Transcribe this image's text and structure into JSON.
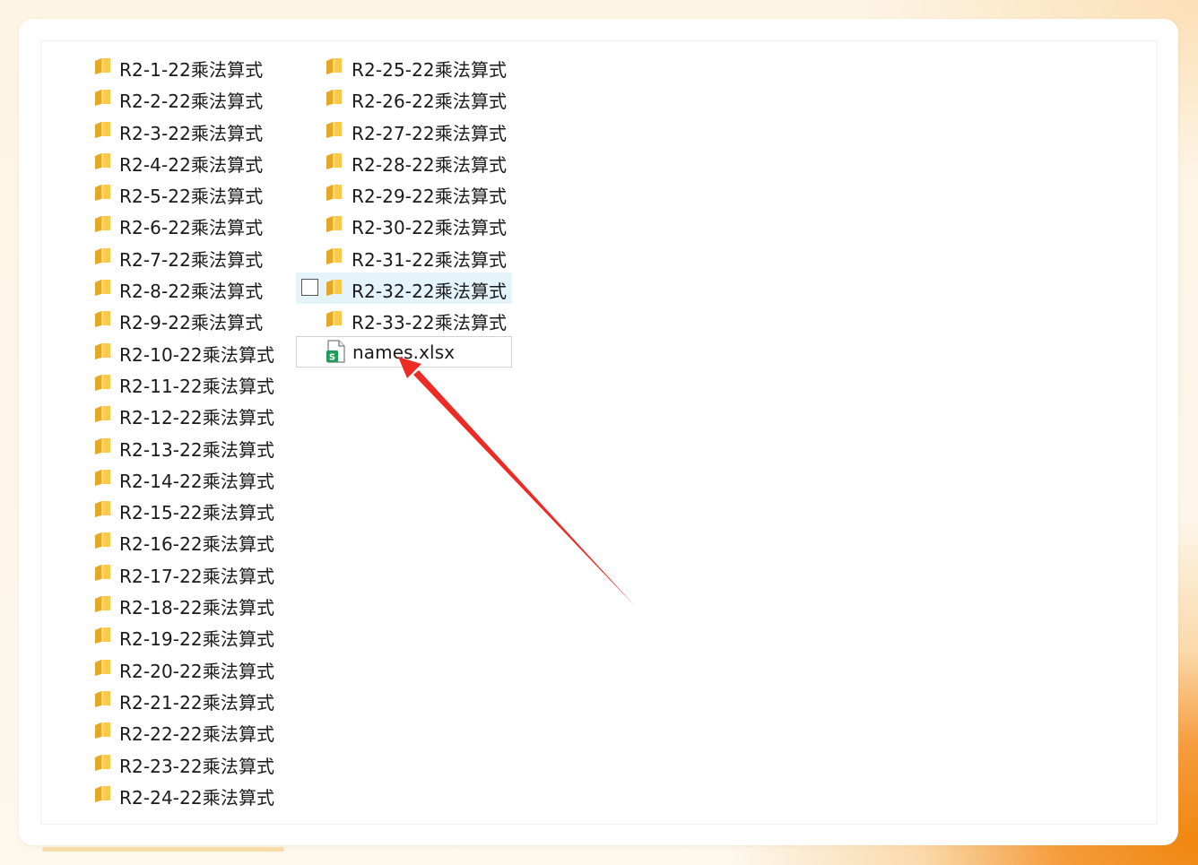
{
  "files_left": [
    "R2-1-22乘法算式",
    "R2-2-22乘法算式",
    "R2-3-22乘法算式",
    "R2-4-22乘法算式",
    "R2-5-22乘法算式",
    "R2-6-22乘法算式",
    "R2-7-22乘法算式",
    "R2-8-22乘法算式",
    "R2-9-22乘法算式",
    "R2-10-22乘法算式",
    "R2-11-22乘法算式",
    "R2-12-22乘法算式",
    "R2-13-22乘法算式",
    "R2-14-22乘法算式",
    "R2-15-22乘法算式",
    "R2-16-22乘法算式",
    "R2-17-22乘法算式",
    "R2-18-22乘法算式",
    "R2-19-22乘法算式",
    "R2-20-22乘法算式",
    "R2-21-22乘法算式",
    "R2-22-22乘法算式",
    "R2-23-22乘法算式",
    "R2-24-22乘法算式"
  ],
  "files_right": [
    "R2-25-22乘法算式",
    "R2-26-22乘法算式",
    "R2-27-22乘法算式",
    "R2-28-22乘法算式",
    "R2-29-22乘法算式",
    "R2-30-22乘法算式",
    "R2-31-22乘法算式",
    "R2-32-22乘法算式",
    "R2-33-22乘法算式"
  ],
  "spreadsheet": {
    "name": "names.xlsx",
    "icon": "spreadsheet-icon",
    "icon_letter": "S"
  },
  "hovered_index": 7,
  "colors": {
    "folder": "#f8c94a",
    "folder_dark": "#e3a826",
    "sheet": "#1e9d5a",
    "arrow": "#ee2a24"
  }
}
